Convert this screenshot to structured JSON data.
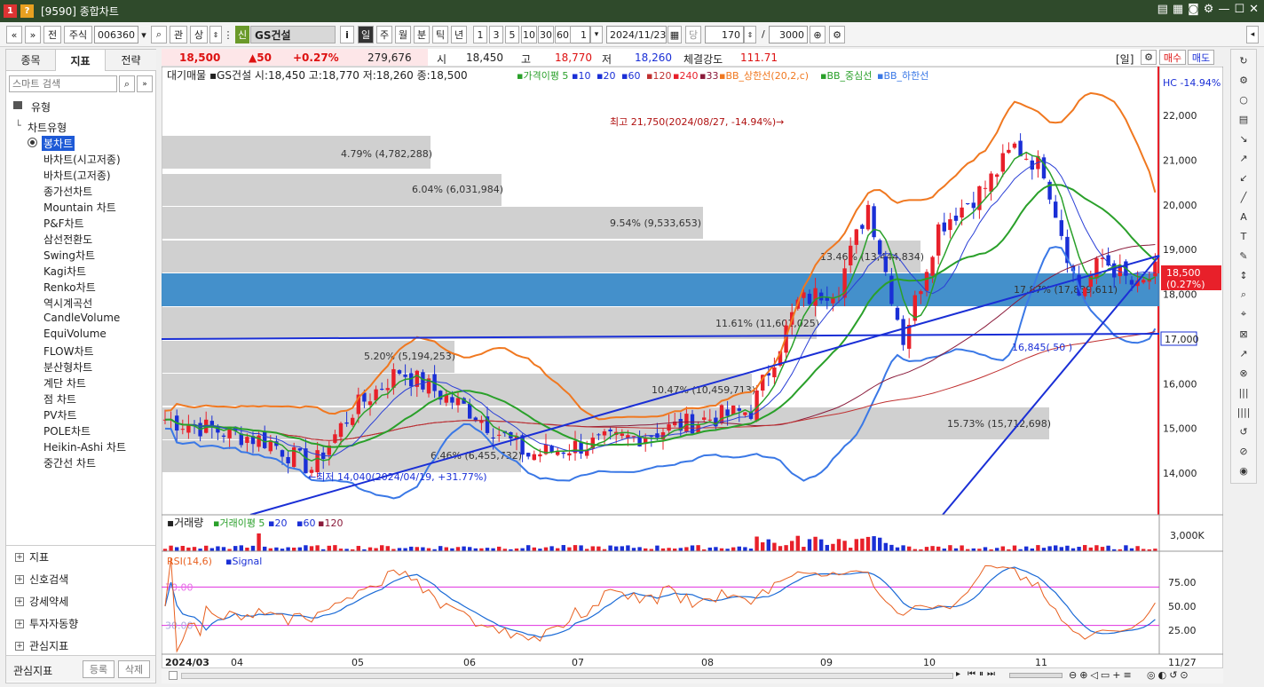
{
  "window": {
    "title": "[9590] 종합차트",
    "badge1": "1",
    "badge2": "?"
  },
  "toolbar": {
    "nav_prev": "«",
    "nav_next": "»",
    "jeon": "전",
    "market": "주식",
    "code": "006360",
    "gwan": "관",
    "sang": "상",
    "sin_badge": "신",
    "stock_name": "GS건설",
    "info_btn": "i",
    "periods": [
      "일",
      "주",
      "월",
      "분",
      "틱",
      "년"
    ],
    "intervals": [
      "1",
      "3",
      "5",
      "10",
      "30",
      "60"
    ],
    "unit": "1",
    "date": "2024/11/23",
    "dang": "당",
    "count": "170",
    "slash": "/",
    "total": "3000"
  },
  "left_panel": {
    "tabs": [
      "종목",
      "지표",
      "전략"
    ],
    "search_placeholder": "스마트 검색",
    "group_label": "유형",
    "subgroup_label": "차트유형",
    "chart_types": [
      "봉차트",
      "바차트(시고저종)",
      "바차트(고저종)",
      "종가선차트",
      "Mountain 차트",
      "P&F차트",
      "삼선전환도",
      "Swing차트",
      "Kagi차트",
      "Renko차트",
      "역시계곡선",
      "CandleVolume",
      "EquiVolume",
      "FLOW차트",
      "분산형차트",
      "계단 차트",
      "점 차트",
      "PV차트",
      "POLE차트",
      "Heikin-Ashi 차트",
      "중간선 차트"
    ],
    "sections": [
      "지표",
      "신호검색",
      "강세약세",
      "투자자동향",
      "관심지표"
    ],
    "footer_label": "관심지표",
    "register_btn": "등록",
    "delete_btn": "삭제"
  },
  "quote": {
    "price": "18,500",
    "change": "▲50",
    "change_pct": "+0.27%",
    "volume": "279,676",
    "open_label": "시",
    "open": "18,450",
    "high_label": "고",
    "high": "18,770",
    "low_label": "저",
    "low": "18,260",
    "strength_label": "체결강도",
    "strength": "111.71",
    "period_badge": "[일]",
    "buy_btn": "매수",
    "sell_btn": "매도"
  },
  "price_legend": {
    "main": "대기매물 ▪GS건설 시:18,450 고:18,770 저:18,260 종:18,500",
    "ma_label": "▪가격이평 5",
    "ma10": "▪10",
    "ma20": "▪20",
    "ma60": "▪60",
    "ma120": "▪120",
    "ma240": "▪240",
    "ma33": "▪33",
    "bb_up": "▪BB_상한선(20,2,c)",
    "bb_mid": "▪BB_중심선",
    "bb_low": "▪BB_하한선"
  },
  "volume_legend": {
    "main": "▪거래량",
    "ma": "▪거래이평 5",
    "p20": "▪20",
    "p60": "▪60",
    "p120": "▪120"
  },
  "rsi_legend": {
    "rsi": "RSI(14,6)",
    "signal": "▪Signal"
  },
  "annotations": {
    "hc": "HC -14.94%",
    "max": "최고 21,750(2024/08/27, -14.94%)→",
    "min": "←최저 14,040(2024/04/19, +31.77%)",
    "current_price": "18,500",
    "current_pct": "(0.27%)",
    "line_price": "17,000",
    "fib_label": "16,845( 50 )",
    "rsi70": "70.00",
    "rsi30": "30.00"
  },
  "volume_profile": [
    {
      "label": "4.79% (4,782,288)"
    },
    {
      "label": "6.04% (6,031,984)"
    },
    {
      "label": "9.54% (9,533,653)"
    },
    {
      "label": "13.46% (13,444,834)"
    },
    {
      "label": "17.87% (17,839,611)"
    },
    {
      "label": "11.61% (11,601,025)"
    },
    {
      "label": "5.20% (5,194,253)"
    },
    {
      "label": "10.47% (10,459,713)"
    },
    {
      "label": "15.73% (15,712,698)"
    },
    {
      "label": "6.46% (6,455,732)"
    }
  ],
  "price_axis": [
    "22,000",
    "21,000",
    "20,000",
    "19,000",
    "18,000",
    "17,000",
    "16,000",
    "15,000",
    "14,000"
  ],
  "volume_axis": [
    "3,000K"
  ],
  "rsi_axis": [
    "75.00",
    "50.00",
    "25.00"
  ],
  "x_axis": [
    "2024/03",
    "04",
    "05",
    "06",
    "07",
    "08",
    "09",
    "10",
    "11",
    "11/27"
  ],
  "colors": {
    "up": "#e8202a",
    "down": "#1a2fd6",
    "ma5": "#2aa02a",
    "ma10": "#2a3fd6",
    "ma20": "#2aa02a",
    "bb_up": "#f07820",
    "bb_low": "#3a78e6",
    "profile": "#c8c8c8",
    "profile_hi": "#3a8ac8"
  },
  "chart_data": {
    "type": "candlestick",
    "ylim": [
      13500,
      22500
    ],
    "close_start": 15200,
    "close_end": 18500,
    "high_max": 21750,
    "low_min": 14040,
    "rsi_levels": [
      70,
      30
    ]
  }
}
